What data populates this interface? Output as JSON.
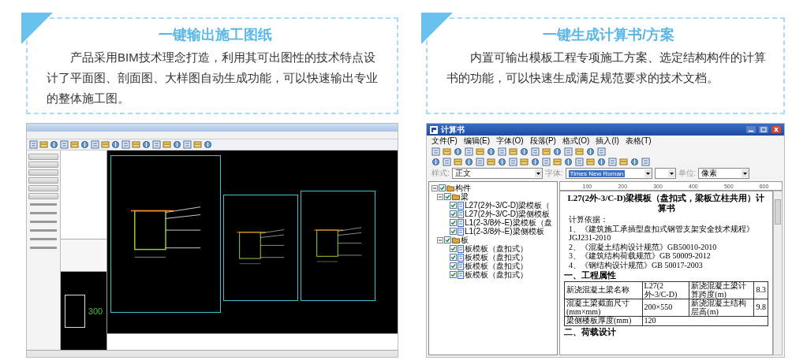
{
  "features": [
    {
      "title": "一键输出施工图纸",
      "description": "产品采用BIM技术理念打造，利用其可出图性的技术特点设计了平面图、剖面图、大样图自动生成功能，可以快速输出专业的整体施工图。"
    },
    {
      "title": "一键生成计算书/方案",
      "description": "内置可输出模板工程专项施工方案、选定结构构件的计算书的功能，可以快速生成满足规范要求的技术文档。"
    }
  ],
  "cad_window": {
    "preview_dimension": "300"
  },
  "calc_window": {
    "title": "计算书",
    "menu": [
      "文件(F)",
      "编辑(E)",
      "字体(O)",
      "段落(P)",
      "格式(O)",
      "插入(I)",
      "表格(T)"
    ],
    "style_label": "样式:",
    "style_value": "正文",
    "font_label": "字体:",
    "font_value": "Times New Roman",
    "unit_label": "单位:",
    "unit_value": "像素",
    "tree": [
      {
        "label": "构件",
        "checked": true,
        "expanded": true,
        "children": [
          {
            "label": "梁",
            "checked": true,
            "expanded": true,
            "children": [
              {
                "label": "L27(2外-3/C-D)梁模板（",
                "checked": true
              },
              {
                "label": "L27(2外-3/C-D)梁侧模板",
                "checked": true
              },
              {
                "label": "L1(2-3/8外-E)梁模板（盘",
                "checked": true
              },
              {
                "label": "L1(2-3/8外-E)梁侧模板",
                "checked": true
              }
            ]
          },
          {
            "label": "板",
            "checked": true,
            "expanded": true,
            "children": [
              {
                "label": "板模板（盘扣式）",
                "checked": true
              },
              {
                "label": "板模板（盘扣式）",
                "checked": true
              },
              {
                "label": "板模板（盘扣式）",
                "checked": true
              },
              {
                "label": "板模板（盘扣式）",
                "checked": true
              }
            ]
          }
        ]
      }
    ],
    "ruler": [
      "100",
      "200",
      "300",
      "400",
      "500",
      "600"
    ],
    "document": {
      "title": "L27(2外-3/C-D)梁模板（盘扣式，梁板立柱共用）计算书",
      "basis_label": "计算依据：",
      "basis": [
        "1、《建筑施工承插型盘扣式钢管支架安全技术规程》JGJ231-2010",
        "2、《混凝土结构设计规范》GB50010-2010",
        "3、《建筑结构荷载规范》GB 50009-2012",
        "4、《钢结构设计规范》GB 50017-2003"
      ],
      "sections": [
        {
          "heading": "一、工程属性",
          "table": [
            [
              "新浇混凝土梁名称",
              "L27(2外-3/C-D)",
              "新浇混凝土梁计算跨度(m)",
              "8.3"
            ],
            [
              "混凝土梁截面尺寸(mm×mm)",
              "200×550",
              "新浇混凝土结构层高(m)",
              "9.8"
            ],
            [
              "梁侧楼板厚度(mm)",
              "120"
            ]
          ]
        },
        {
          "heading": "二、荷载设计"
        }
      ]
    }
  }
}
